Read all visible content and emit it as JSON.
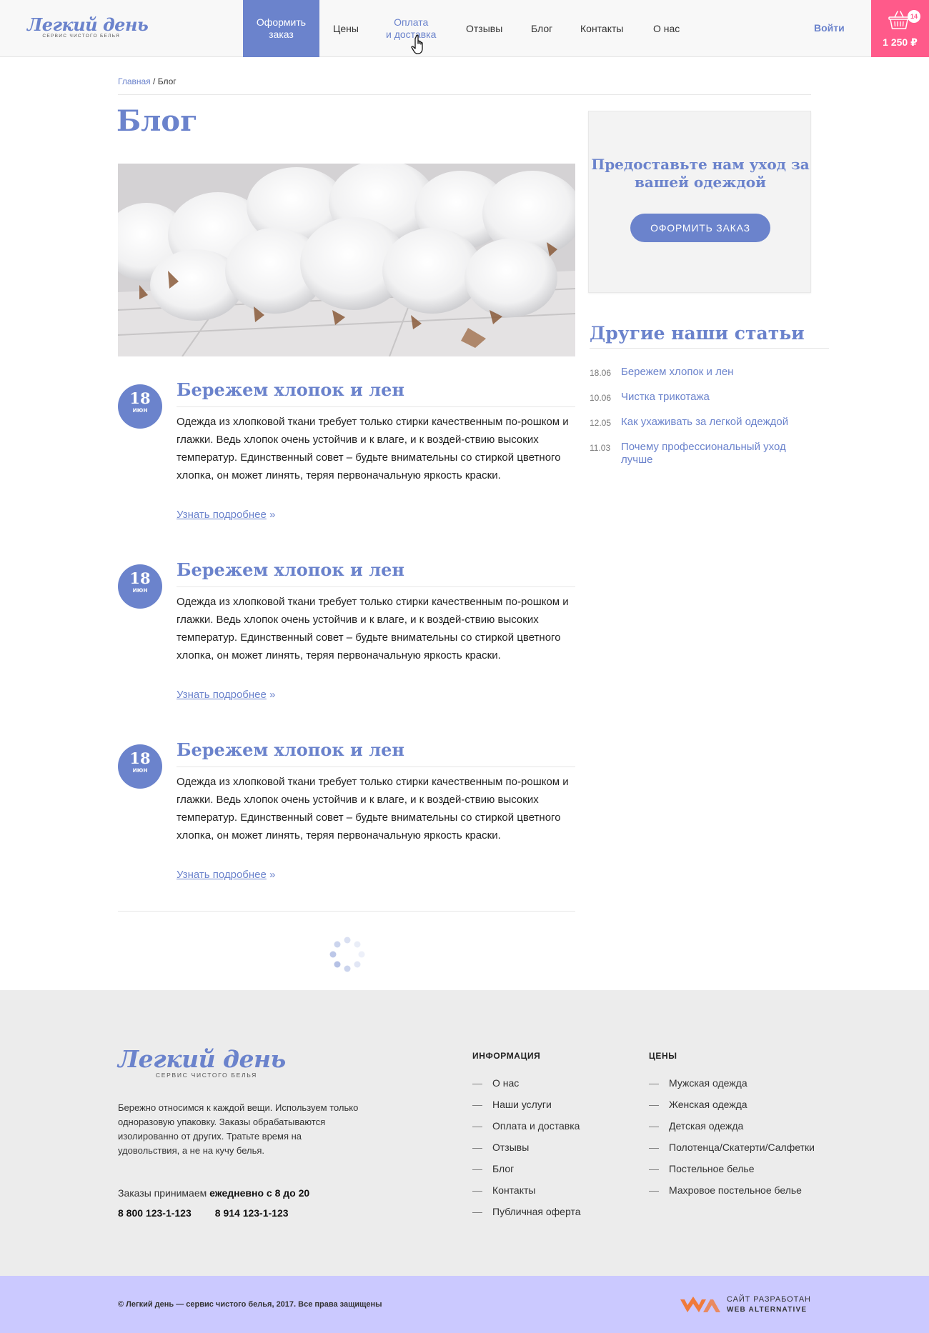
{
  "header": {
    "logo_title": "Легкий день",
    "logo_sub": "сервис чистого белья",
    "nav_order_line1": "Оформить",
    "nav_order_line2": "заказ",
    "nav": {
      "prices": "Цены",
      "payment_line1": "Оплата",
      "payment_line2": "и доставка",
      "reviews": "Отзывы",
      "blog": "Блог",
      "contacts": "Контакты",
      "about": "О нас"
    },
    "login": "Войти",
    "cart_count": "14",
    "cart_sum": "1 250 ₽"
  },
  "breadcrumb": {
    "home": "Главная",
    "separator": " / ",
    "current": "Блог"
  },
  "page_title": "Блог",
  "posts": [
    {
      "day": "18",
      "month": "июн",
      "title": "Бережем хлопок и лен",
      "text": "Одежда из хлопковой ткани требует только стирки качественным по-рошком и глажки. Ведь хлопок очень устойчив и к влаге, и к воздей-ствию высоких температур. Единственный совет – будьте внимательны со стиркой цветного хлопка, он может линять, теряя первоначальную яркость краски.",
      "more": "Узнать подробнее",
      "more_arrow": " »"
    },
    {
      "day": "18",
      "month": "июн",
      "title": "Бережем хлопок и лен",
      "text": "Одежда из хлопковой ткани требует только стирки качественным по-рошком и глажки. Ведь хлопок очень устойчив и к влаге, и к воздей-ствию высоких температур. Единственный совет – будьте внимательны со стиркой цветного хлопка, он может линять, теряя первоначальную яркость краски.",
      "more": "Узнать подробнее",
      "more_arrow": " »"
    },
    {
      "day": "18",
      "month": "июн",
      "title": "Бережем хлопок и лен",
      "text": "Одежда из хлопковой ткани требует только стирки качественным по-рошком и глажки. Ведь хлопок очень устойчив и к влаге, и к воздей-ствию высоких температур. Единственный совет – будьте внимательны со стиркой цветного хлопка, он может линять, теряя первоначальную яркость краски.",
      "more": "Узнать подробнее",
      "more_arrow": " »"
    }
  ],
  "sidebar": {
    "cta_text": "Предоставьте нам уход за вашей одеждой",
    "cta_button": "Оформить заказ",
    "other_title": "Другие наши статьи",
    "articles": [
      {
        "date": "18.06",
        "title": "Бережем хлопок и лен"
      },
      {
        "date": "10.06",
        "title": "Чистка трикотажа"
      },
      {
        "date": "12.05",
        "title": "Как ухаживать за легкой одеждой"
      },
      {
        "date": "11.03",
        "title": "Почему профессиональный уход лучше"
      }
    ]
  },
  "footer": {
    "logo_title": "Легкий день",
    "logo_sub": "сервис чистого белья",
    "about": "Бережно относимся к каждой вещи. Используем только одноразовую упаковку. Заказы обрабатываются изолированно от других. Тратьте время на удовольствия, а не на кучу белья.",
    "hours_prefix": "Заказы принимаем ",
    "hours_bold": "ежедневно с 8 до 20",
    "phone1": "8 800 123-1-123",
    "phone2": "8 914  123-1-123",
    "info_title": "Информация",
    "info_links": [
      "О нас",
      "Наши услуги",
      "Оплата и доставка",
      "Отзывы",
      "Блог",
      "Контакты",
      "Публичная оферта"
    ],
    "prices_title": "Цены",
    "prices_links": [
      "Мужская одежда",
      "Женская одежда",
      "Детская одежда",
      "Полотенца/Скатерти/Салфетки",
      "Постельное белье",
      "Махровое постельное белье"
    ],
    "copyright": "© Легкий день — сервис чистого белья, 2017. Все права защищены",
    "dev_line1": "САЙТ РАЗРАБОТАН",
    "dev_line2": "WEB ALTERNATIVE"
  },
  "colors": {
    "accent": "#6b83cc",
    "cart": "#ff5a8a",
    "footer_bg": "#ececec",
    "bottom_bg": "#cbc9ff",
    "dev_logo": "#f07a3a"
  }
}
